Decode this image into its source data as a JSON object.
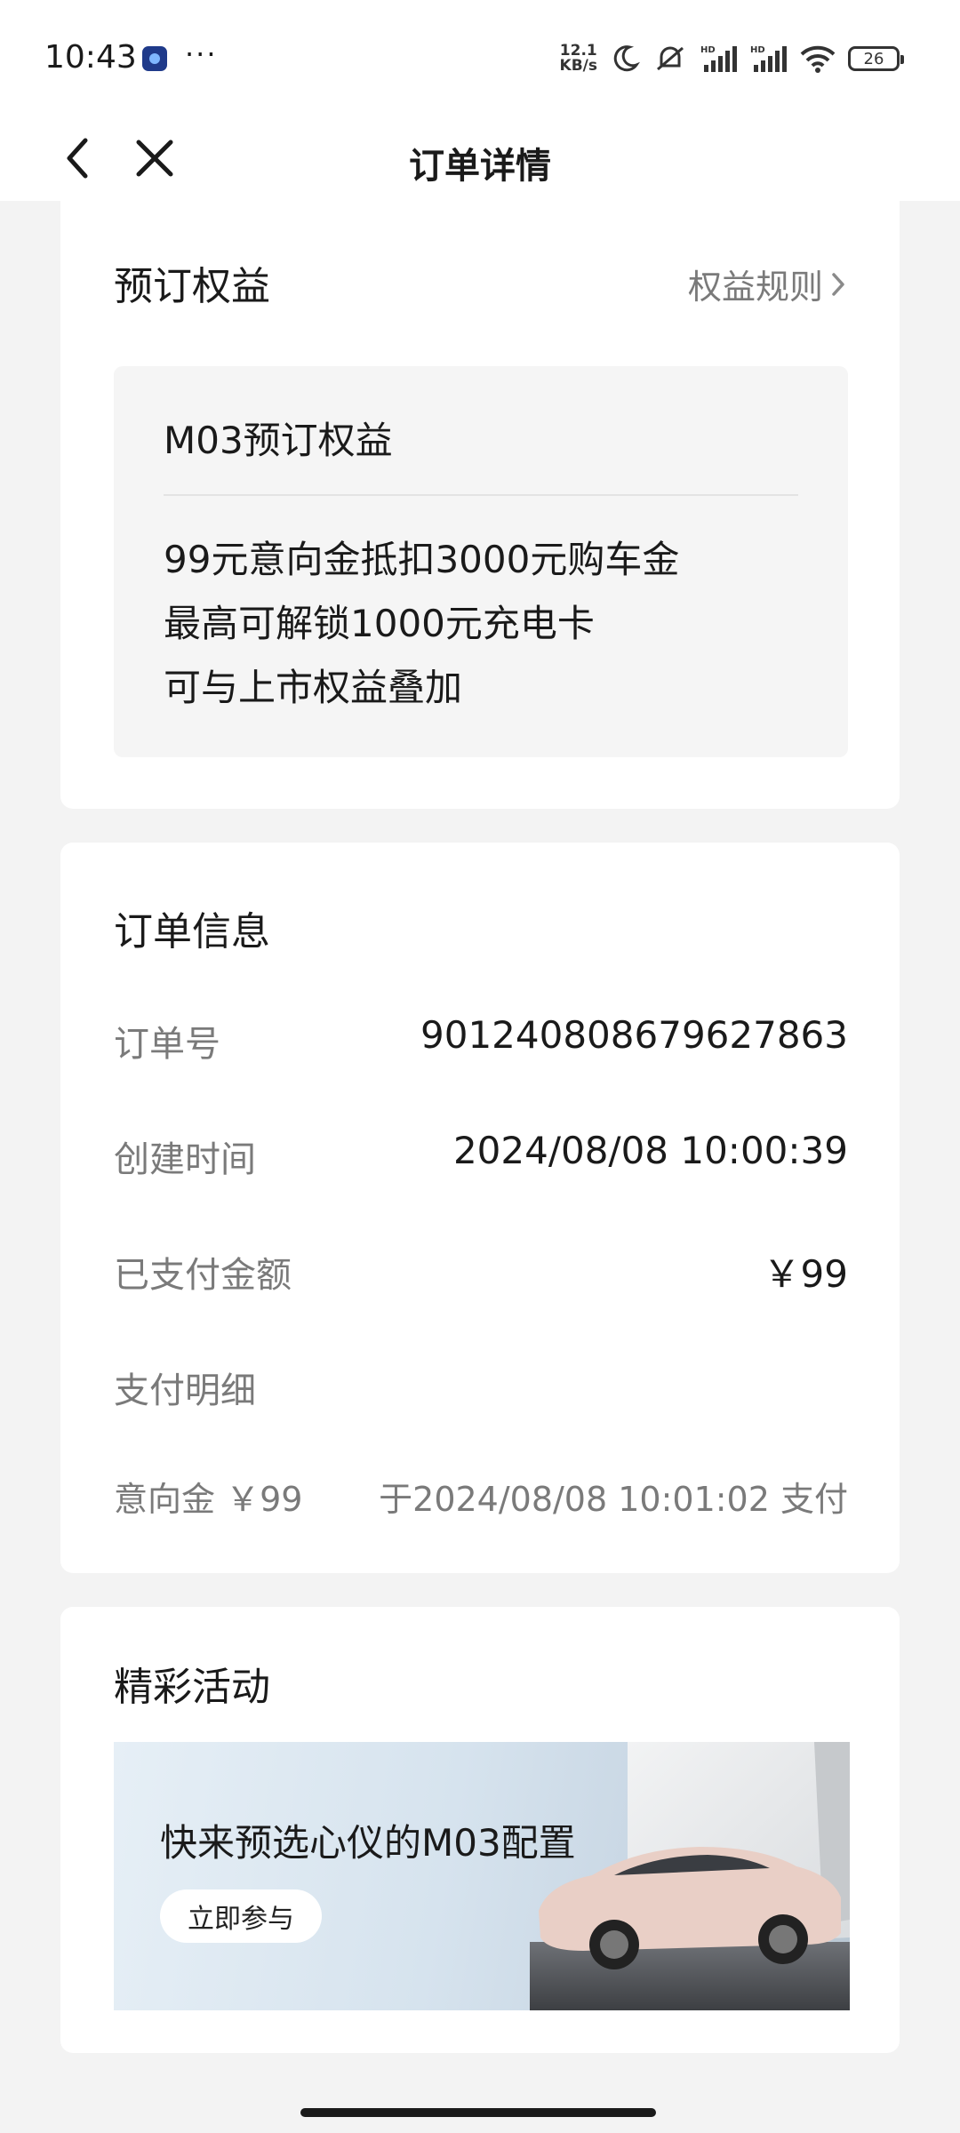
{
  "status_bar": {
    "time": "10:43",
    "net_speed_value": "12.1",
    "net_speed_unit": "KB/s",
    "battery": "26",
    "icons": [
      "app-icon",
      "moon-icon",
      "mute-icon",
      "signal-icon",
      "signal-icon",
      "wifi-icon"
    ]
  },
  "nav": {
    "title": "订单详情",
    "back_icon": "chevron-left-icon",
    "close_icon": "close-icon"
  },
  "benefits": {
    "title": "预订权益",
    "rules_link": "权益规则",
    "box_title": "M03预订权益",
    "lines": [
      "99元意向金抵扣3000元购车金",
      "最高可解锁1000元充电卡",
      "可与上市权益叠加"
    ]
  },
  "order_info": {
    "title": "订单信息",
    "rows": [
      {
        "label": "订单号",
        "value": "901240808679627863"
      },
      {
        "label": "创建时间",
        "value": "2024/08/08 10:00:39"
      },
      {
        "label": "已支付金额",
        "value": "￥99"
      }
    ],
    "payment_detail_label": "支付明细",
    "payment_detail": {
      "label": "意向金 ￥99",
      "value": "于2024/08/08 10:01:02 支付"
    }
  },
  "activities": {
    "title": "精彩活动",
    "banner_title": "快来预选心仪的M03配置",
    "banner_button": "立即参与"
  },
  "colors": {
    "background": "#f3f3f3",
    "card": "#ffffff",
    "secondary_text": "#7a7a7a",
    "car_body": "#e9cfc6"
  }
}
